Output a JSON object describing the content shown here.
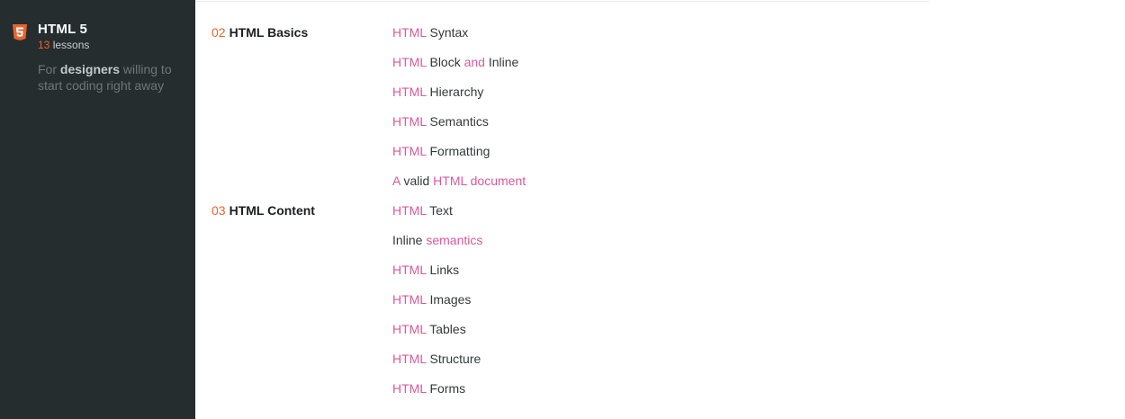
{
  "course": {
    "title": "HTML 5",
    "lessons_count": "13",
    "lessons_word": "lessons",
    "desc_prefix": "For ",
    "desc_bold": "designers",
    "desc_suffix": " willing to start coding right away",
    "badge_icon": "html5-shield-icon",
    "accent_color": "#e8642c"
  },
  "chapters": [
    {
      "number": "02",
      "title": "HTML Basics",
      "lessons": [
        {
          "parts": [
            {
              "t": "HTML",
              "hl": true
            },
            {
              "t": " Syntax",
              "hl": false
            }
          ]
        },
        {
          "parts": [
            {
              "t": "HTML",
              "hl": true
            },
            {
              "t": " Block ",
              "hl": false
            },
            {
              "t": "and",
              "hl": true
            },
            {
              "t": " Inline",
              "hl": false
            }
          ]
        },
        {
          "parts": [
            {
              "t": "HTML",
              "hl": true
            },
            {
              "t": " Hierarchy",
              "hl": false
            }
          ]
        },
        {
          "parts": [
            {
              "t": "HTML",
              "hl": true
            },
            {
              "t": " Semantics",
              "hl": false
            }
          ]
        },
        {
          "parts": [
            {
              "t": "HTML",
              "hl": true
            },
            {
              "t": " Formatting",
              "hl": false
            }
          ]
        },
        {
          "parts": [
            {
              "t": "A",
              "hl": true
            },
            {
              "t": " valid ",
              "hl": false
            },
            {
              "t": "HTML document",
              "hl": true
            }
          ]
        }
      ]
    },
    {
      "number": "03",
      "title": "HTML Content",
      "lessons": [
        {
          "parts": [
            {
              "t": "HTML",
              "hl": true
            },
            {
              "t": " Text",
              "hl": false
            }
          ]
        },
        {
          "parts": [
            {
              "t": "Inline ",
              "hl": false
            },
            {
              "t": "semantics",
              "hl": true
            }
          ]
        },
        {
          "parts": [
            {
              "t": "HTML",
              "hl": true
            },
            {
              "t": " Links",
              "hl": false
            }
          ]
        },
        {
          "parts": [
            {
              "t": "HTML",
              "hl": true
            },
            {
              "t": " Images",
              "hl": false
            }
          ]
        },
        {
          "parts": [
            {
              "t": "HTML",
              "hl": true
            },
            {
              "t": " Tables",
              "hl": false
            }
          ]
        },
        {
          "parts": [
            {
              "t": "HTML",
              "hl": true
            },
            {
              "t": " Structure",
              "hl": false
            }
          ]
        },
        {
          "parts": [
            {
              "t": "HTML",
              "hl": true
            },
            {
              "t": " Forms",
              "hl": false
            }
          ]
        }
      ]
    }
  ],
  "colors": {
    "sidebar_bg": "#262d2f",
    "keyword": "#d95a9a",
    "number": "#e8642c"
  }
}
